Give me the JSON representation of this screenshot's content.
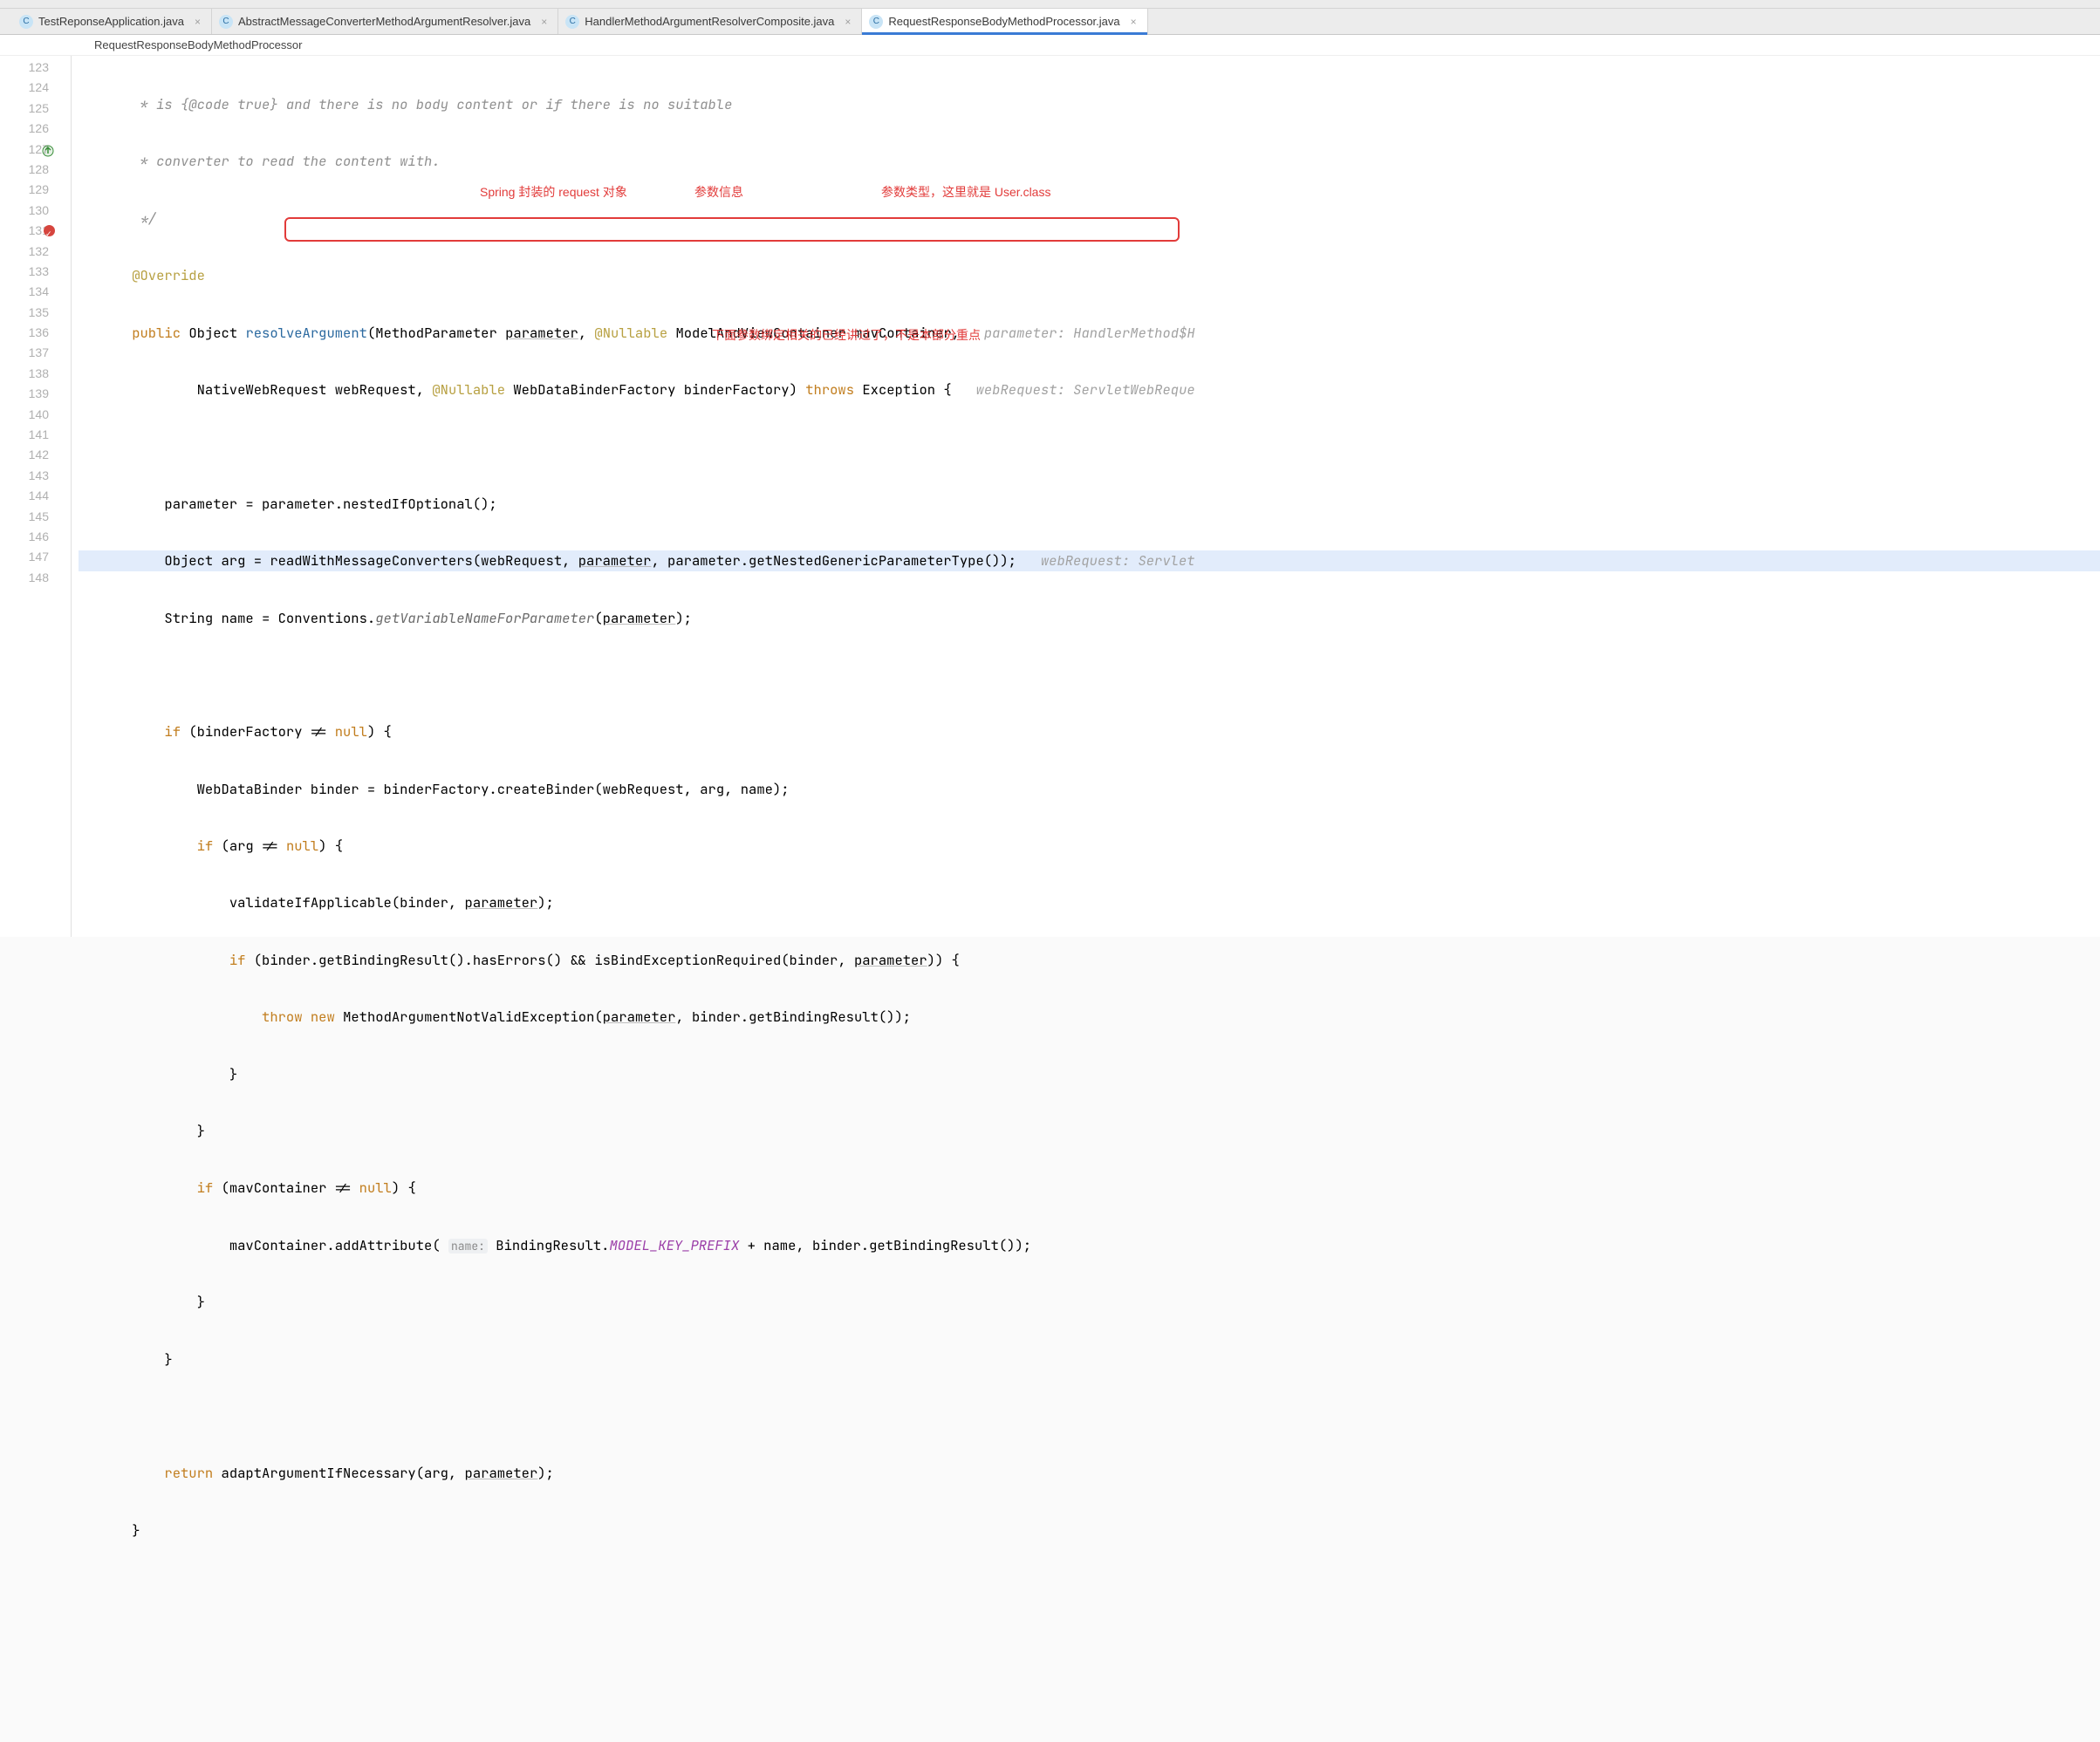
{
  "tabs": [
    {
      "label": "TestReponseApplication.java",
      "icon": "C",
      "active": false
    },
    {
      "label": "AbstractMessageConverterMethodArgumentResolver.java",
      "icon": "C",
      "active": false
    },
    {
      "label": "HandlerMethodArgumentResolverComposite.java",
      "icon": "C",
      "active": false
    },
    {
      "label": "RequestResponseBodyMethodProcessor.java",
      "icon": "C",
      "active": true
    }
  ],
  "breadcrumb": "RequestResponseBodyMethodProcessor",
  "gutter": {
    "start": 123,
    "end": 148,
    "override_line": 127,
    "breakpoint_line": 131
  },
  "annotations": {
    "a1": "Spring 封装的 request 对象",
    "a2": "参数信息",
    "a3": "参数类型，这里就是 User.class",
    "a4": "下面参数绑定相关的已经讲过了，不是本部分重点"
  },
  "inlay": {
    "l127": "parameter: HandlerMethod$H",
    "l128": "webRequest: ServletWebReque",
    "l131": "webRequest: Servlet"
  },
  "hint": {
    "name": "name:"
  },
  "code": {
    "c123": " * is {@code true} and there is no body content or if there is no suitable",
    "c124": " * converter to read the content with.",
    "c125": " */",
    "l126_ann": "@Override",
    "l127": {
      "kw_public": "public",
      "ret": "Object",
      "method": "resolveArgument",
      "p1_type": "MethodParameter",
      "p1_name": "parameter",
      "ann": "@Nullable",
      "p2_type": "ModelAndViewContainer",
      "p2_name": "mavContainer"
    },
    "l128": {
      "p3_type": "NativeWebRequest",
      "p3_name": "webRequest",
      "ann": "@Nullable",
      "p4_type": "WebDataBinderFactory",
      "p4_name": "binderFactory",
      "kw_throws": "throws",
      "exc": "Exception"
    },
    "l130": "parameter = parameter.nestedIfOptional();",
    "l131": {
      "lhs": "Object arg =",
      "call": "readWithMessageConverters(webRequest, ",
      "p": "parameter",
      "rest": ", parameter.getNestedGenericParameterType());"
    },
    "l132": {
      "a": "String name = Conventions.",
      "m": "getVariableNameForParameter",
      "b": "(",
      "p": "parameter",
      "c": ");"
    },
    "l134": {
      "kw_if": "if",
      "cond": "(binderFactory != ",
      "kw_null": "null",
      "tail": ") {"
    },
    "l135": "WebDataBinder binder = binderFactory.createBinder(webRequest, arg, name);",
    "l136": {
      "kw_if": "if",
      "a": "(arg != ",
      "kw_null": "null",
      "b": ") {"
    },
    "l137": {
      "a": "validateIfApplicable(binder, ",
      "p": "parameter",
      "b": ");"
    },
    "l138": {
      "kw_if": "if",
      "a": "(binder.getBindingResult().hasErrors() && isBindExceptionRequired(binder, ",
      "p": "parameter",
      "b": ")) {"
    },
    "l139": {
      "kw_throw": "throw",
      "kw_new": "new",
      "a": "MethodArgumentNotValidException(",
      "p": "parameter",
      "b": ", binder.getBindingResult());"
    },
    "l140": "}",
    "l141": "}",
    "l142": {
      "kw_if": "if",
      "a": "(mavContainer != ",
      "kw_null": "null",
      "b": ") {"
    },
    "l143": {
      "a": "mavContainer.addAttribute(",
      "b": "BindingResult.",
      "c": "MODEL_KEY_PREFIX",
      "d": " + name, binder.getBindingResult());"
    },
    "l144": "}",
    "l145": "}",
    "l147": {
      "kw_return": "return",
      "a": "adaptArgumentIfNecessary(arg, ",
      "p": "parameter",
      "b": ");"
    },
    "l148": "}"
  }
}
